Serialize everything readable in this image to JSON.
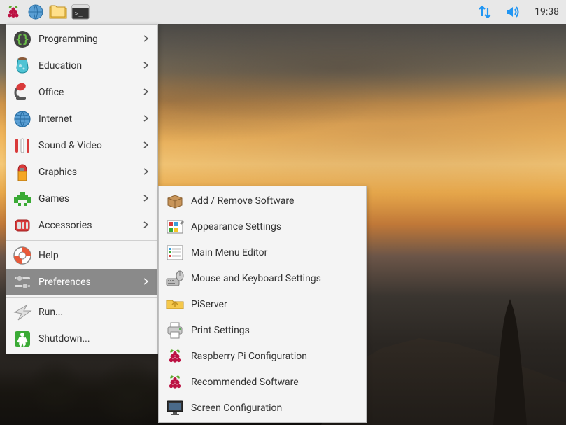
{
  "taskbar": {
    "clock": "19:38"
  },
  "menu": {
    "items": [
      {
        "label": "Programming",
        "icon": "programming",
        "submenu": true
      },
      {
        "label": "Education",
        "icon": "education",
        "submenu": true
      },
      {
        "label": "Office",
        "icon": "office",
        "submenu": true
      },
      {
        "label": "Internet",
        "icon": "internet",
        "submenu": true
      },
      {
        "label": "Sound & Video",
        "icon": "sound-video",
        "submenu": true
      },
      {
        "label": "Graphics",
        "icon": "graphics",
        "submenu": true
      },
      {
        "label": "Games",
        "icon": "games",
        "submenu": true
      },
      {
        "label": "Accessories",
        "icon": "accessories",
        "submenu": true
      },
      {
        "label": "Help",
        "icon": "help",
        "submenu": false
      },
      {
        "label": "Preferences",
        "icon": "preferences",
        "submenu": true,
        "selected": true
      },
      {
        "label": "Run...",
        "icon": "run",
        "submenu": false
      },
      {
        "label": "Shutdown...",
        "icon": "shutdown",
        "submenu": false
      }
    ]
  },
  "submenu": {
    "items": [
      {
        "label": "Add / Remove Software",
        "icon": "package"
      },
      {
        "label": "Appearance Settings",
        "icon": "appearance"
      },
      {
        "label": "Main Menu Editor",
        "icon": "menu-editor"
      },
      {
        "label": "Mouse and Keyboard Settings",
        "icon": "mouse-keyboard"
      },
      {
        "label": "PiServer",
        "icon": "piserver"
      },
      {
        "label": "Print Settings",
        "icon": "print"
      },
      {
        "label": "Raspberry Pi Configuration",
        "icon": "raspberry"
      },
      {
        "label": "Recommended Software",
        "icon": "raspberry"
      },
      {
        "label": "Screen Configuration",
        "icon": "screen"
      }
    ]
  }
}
